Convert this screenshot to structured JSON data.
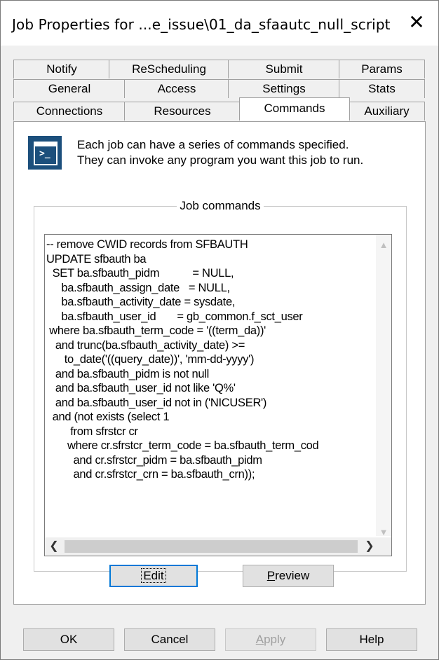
{
  "window": {
    "title": "Job Properties for ...e_issue\\01_da_sfaautc_null_script",
    "close_glyph": "✕"
  },
  "tabs": {
    "row1": [
      "Notify",
      "ReScheduling",
      "Submit",
      "Params"
    ],
    "row2": [
      "General",
      "Access",
      "Settings",
      "Stats"
    ],
    "row3": [
      "Connections",
      "Resources",
      "Commands",
      "Auxiliary"
    ],
    "active": "Commands"
  },
  "info": {
    "icon": "command-prompt-icon",
    "icon_text": ">_",
    "line1": "Each job can have a series of commands specified.",
    "line2": "They can invoke any program you want this job to run."
  },
  "commands": {
    "group_label": "Job commands",
    "lines": [
      "-- remove CWID records from SFBAUTH",
      "UPDATE sfbauth ba",
      "  SET ba.sfbauth_pidm           = NULL,",
      "     ba.sfbauth_assign_date   = NULL,",
      "     ba.sfbauth_activity_date = sysdate,",
      "     ba.sfbauth_user_id       = gb_common.f_sct_user",
      " where ba.sfbauth_term_code = '((term_da))'",
      "   and trunc(ba.sfbauth_activity_date) >=",
      "      to_date('((query_date))', 'mm-dd-yyyy')",
      "   and ba.sfbauth_pidm is not null",
      "   and ba.sfbauth_user_id not like 'Q%'",
      "   and ba.sfbauth_user_id not in ('NICUSER')",
      "  and (not exists (select 1",
      "        from sfrstcr cr",
      "       where cr.sfrstcr_term_code = ba.sfbauth_term_cod",
      "         and cr.sfrstcr_pidm = ba.sfbauth_pidm",
      "         and cr.sfrstcr_crn = ba.sfbauth_crn));"
    ]
  },
  "panel_buttons": {
    "edit": "Edit",
    "preview_accel": "P",
    "preview_rest": "review"
  },
  "dialog_buttons": {
    "ok": "OK",
    "cancel": "Cancel",
    "apply_accel": "A",
    "apply_rest": "pply",
    "help": "Help"
  }
}
